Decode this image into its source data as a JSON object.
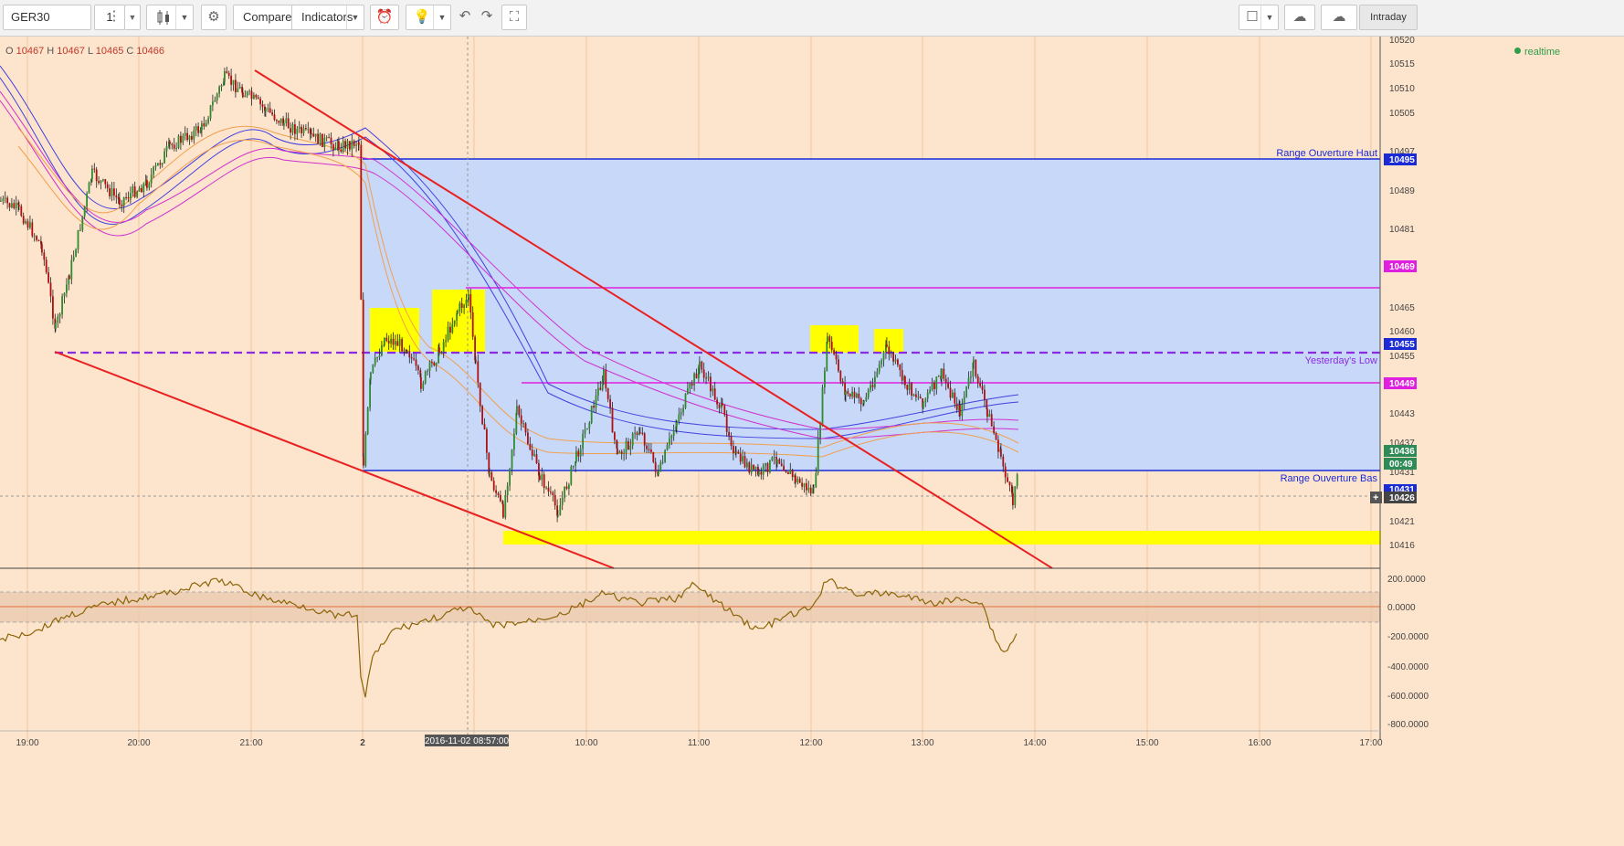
{
  "toolbar": {
    "symbol": "GER30",
    "interval": "1",
    "compare_label": "Compare",
    "indicators_label": "Indicators",
    "timeframe_label": "Intraday"
  },
  "legend": {
    "o_label": "O",
    "o": "10467",
    "h_label": "H",
    "h": "10467",
    "l_label": "L",
    "l": "10465",
    "c_label": "C",
    "c": "10466",
    "realtime": "realtime"
  },
  "price_axis": {
    "ticks": [
      "10520",
      "10515",
      "10510",
      "10505",
      "10497",
      "10489",
      "10481",
      "10465",
      "10460",
      "10455",
      "10443",
      "10437",
      "10431",
      "10421",
      "10416"
    ]
  },
  "price_badges": [
    {
      "value": "10495",
      "color": "#1a2bd6"
    },
    {
      "value": "10469",
      "color": "#e020e0"
    },
    {
      "value": "10455",
      "color": "#1a2bd6"
    },
    {
      "value": "10449",
      "color": "#e020e0"
    },
    {
      "value": "10436",
      "color": "#2e8b57"
    },
    {
      "value": "00:49",
      "color": "#2e8b57"
    },
    {
      "value": "10431",
      "color": "#1a2bd6"
    },
    {
      "value": "10426",
      "color": "#444444"
    }
  ],
  "level_labels": {
    "range_high": "Range Ouverture Haut",
    "yesterday_low": "Yesterday's Low",
    "range_low": "Range Ouverture Bas"
  },
  "osc_axis": {
    "ticks": [
      "200.0000",
      "0.0000",
      "-200.0000",
      "-400.0000",
      "-600.0000",
      "-800.0000"
    ]
  },
  "time_axis": {
    "ticks": [
      "19:00",
      "20:00",
      "21:00",
      "2",
      "10:00",
      "11:00",
      "12:00",
      "13:00",
      "14:00",
      "15:00",
      "16:00",
      "17:00"
    ],
    "cursor": "2016-11-02 08:57:00"
  },
  "colors": {
    "background": "#fde4cc",
    "range_fill": "#c8d8f8",
    "range_line": "#1a2bd6",
    "magenta_line": "#e020e0",
    "yesterday_low": "#8a2be2",
    "trendline": "#e82020",
    "highlight": "#ffff00",
    "oscillator": "#8b6508"
  }
}
